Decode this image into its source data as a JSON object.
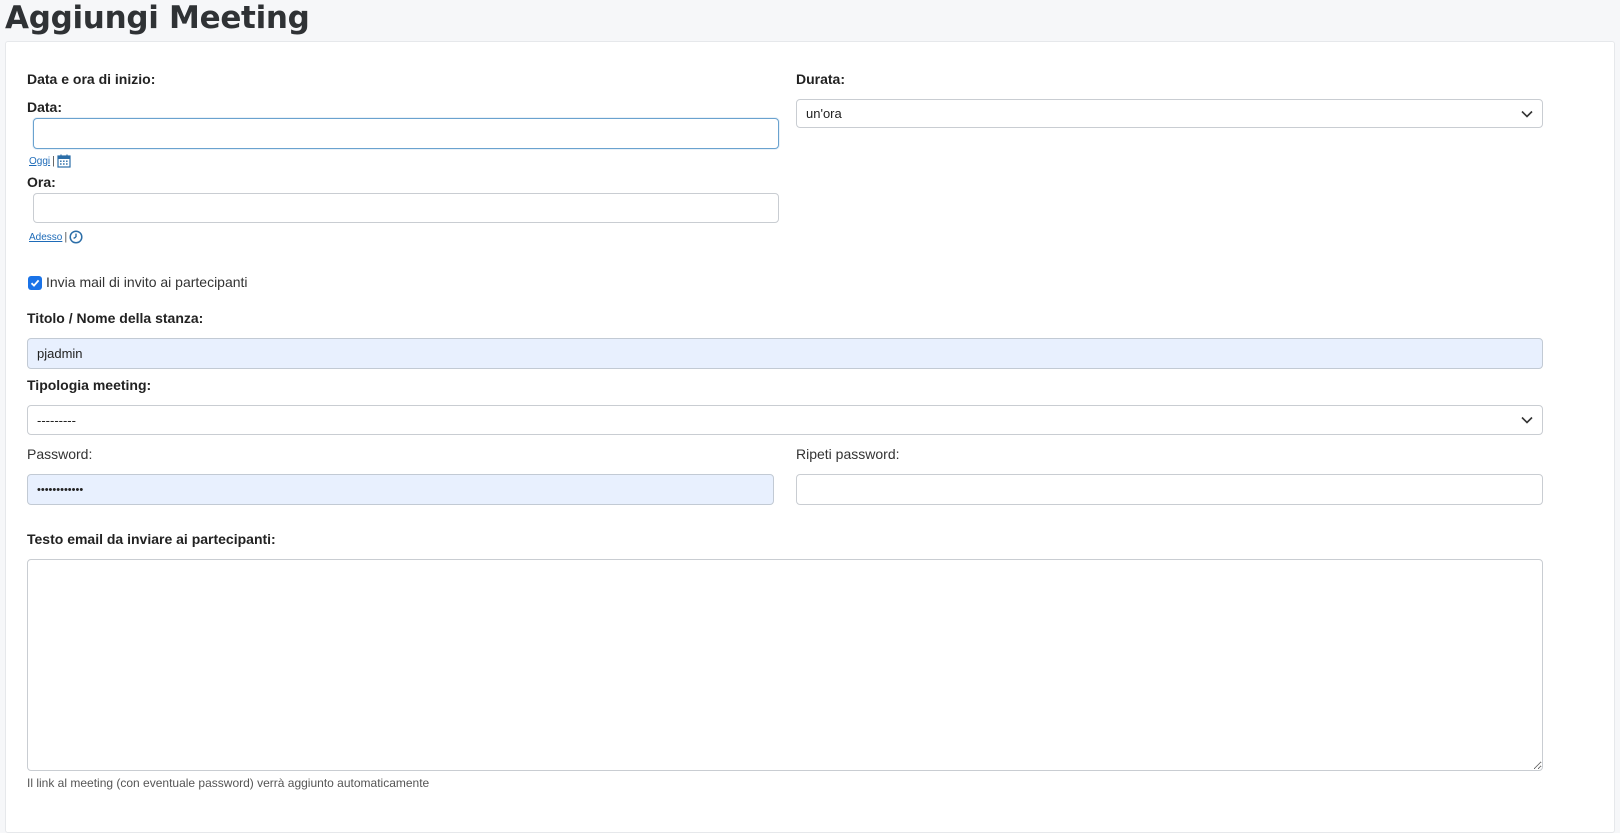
{
  "page": {
    "title": "Aggiungi Meeting"
  },
  "form": {
    "start_label": "Data e ora di inizio:",
    "date": {
      "label": "Data:",
      "value": "",
      "today_link": "Oggi",
      "separator": "|"
    },
    "time": {
      "label": "Ora:",
      "value": "",
      "now_link": "Adesso",
      "separator": "|"
    },
    "duration": {
      "label": "Durata:",
      "selected": "un'ora"
    },
    "send_invite": {
      "label": "Invia mail di invito ai partecipanti",
      "checked": true
    },
    "title": {
      "label": "Titolo / Nome della stanza:",
      "value": "pjadmin"
    },
    "meeting_type": {
      "label": "Tipologia meeting:",
      "selected": "---------"
    },
    "password": {
      "label": "Password:",
      "value": "••••••••••••"
    },
    "repeat_password": {
      "label": "Ripeti password:",
      "value": ""
    },
    "email_text": {
      "label": "Testo email da inviare ai partecipanti:",
      "value": "",
      "help": "Il link al meeting (con eventuale password) verrà aggiunto automaticamente"
    }
  },
  "colors": {
    "accent": "#1a73e8",
    "link": "#1e6bb8",
    "autofill": "#e8f0fe"
  }
}
